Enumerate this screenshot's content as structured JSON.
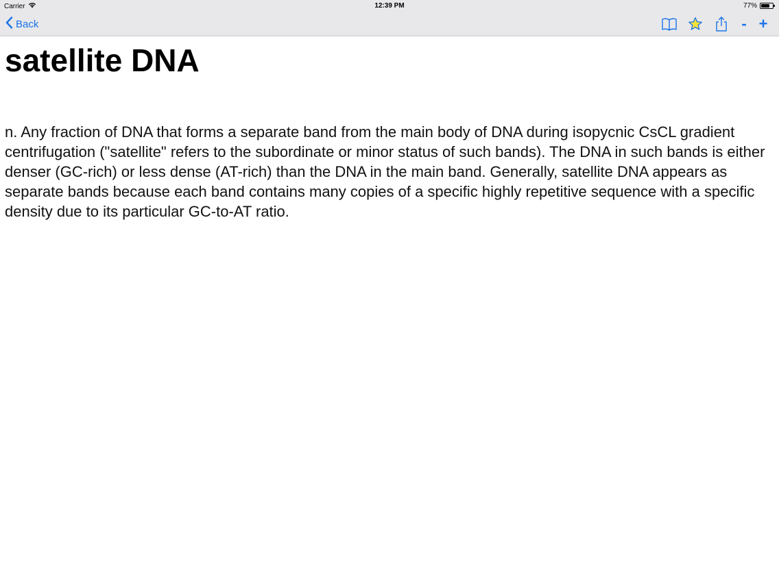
{
  "status_bar": {
    "carrier": "Carrier",
    "time": "12:39 PM",
    "battery_percent": "77%",
    "battery_level": 0.77
  },
  "nav_bar": {
    "back_label": "Back",
    "zoom_out_label": "-",
    "zoom_in_label": "+",
    "icons": [
      "book-icon",
      "star-icon",
      "share-icon"
    ],
    "accent_color": "#1a73e8",
    "star_fill_color": "#f5e23a"
  },
  "entry": {
    "term": "satellite DNA",
    "definition": "n. Any fraction of DNA that forms a separate band from the main body of DNA during isopycnic CsCL gradient centrifugation (\"satellite\" refers to the subordinate or minor status of such bands). The DNA in such bands is either denser (GC-rich) or less dense (AT-rich) than the DNA in the main band. Generally, satellite DNA appears as separate bands because each band contains many copies of a specific highly repetitive sequence with a specific density due to its particular GC-to-AT ratio."
  }
}
